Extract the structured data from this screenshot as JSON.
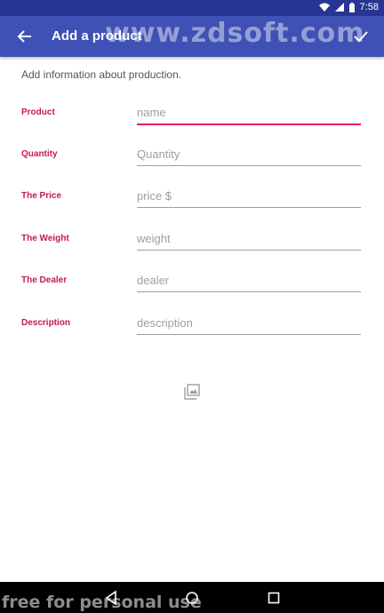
{
  "status_bar": {
    "time": "7:58"
  },
  "app_bar": {
    "title": "Add a product",
    "watermark": "www.zdsoft.com"
  },
  "subtitle": "Add information about production.",
  "form": {
    "fields": [
      {
        "label": "Product",
        "placeholder": "name"
      },
      {
        "label": "Quantity",
        "placeholder": "Quantity"
      },
      {
        "label": "The Price",
        "placeholder": "price $"
      },
      {
        "label": "The Weight",
        "placeholder": "weight"
      },
      {
        "label": "The Dealer",
        "placeholder": "dealer"
      },
      {
        "label": "Description",
        "placeholder": "description"
      }
    ]
  },
  "colors": {
    "primary": "#3F51B5",
    "primary_dark": "#283593",
    "accent": "#E91E63",
    "label": "#C2185B"
  },
  "icons": [
    "wifi-icon",
    "signal-icon",
    "battery-icon",
    "back-arrow-icon",
    "check-icon",
    "image-icon",
    "nav-back-icon",
    "nav-home-icon",
    "nav-recents-icon"
  ],
  "watermark_bottom": "free for personal use"
}
